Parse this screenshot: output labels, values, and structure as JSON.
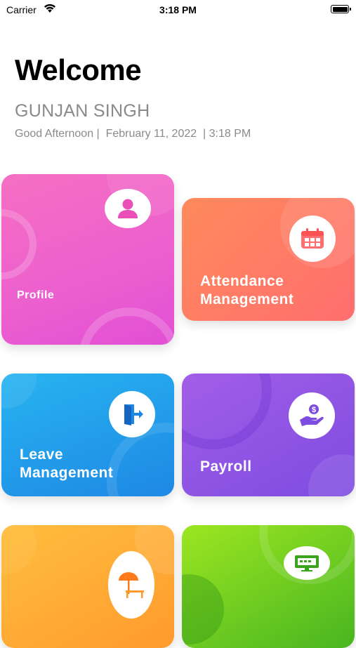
{
  "status_bar": {
    "carrier": "Carrier",
    "time": "3:18 PM",
    "wifi_icon": "wifi-icon",
    "battery_icon": "battery-icon"
  },
  "header": {
    "title": "Welcome",
    "user_name": "GUNJAN SINGH",
    "greeting": "Good Afternoon |  February 11, 2022  | 3:18 PM"
  },
  "tiles": [
    {
      "label": "Profile",
      "icon": "user-icon",
      "color_from": "#f56fc2",
      "color_to": "#e24fd5"
    },
    {
      "label": "Attendance Management",
      "line1": "Attendance",
      "line2": "Management",
      "icon": "calendar-icon",
      "color_from": "#ff8a5c",
      "color_to": "#ff6e6e"
    },
    {
      "label": "Leave Management",
      "line1": "Leave",
      "line2": "Management",
      "icon": "exit-door-icon",
      "color_from": "#28b4f0",
      "color_to": "#1e88e5"
    },
    {
      "label": "Payroll",
      "icon": "hand-dollar-icon",
      "color_from": "#a35ee8",
      "color_to": "#7d4ce0"
    },
    {
      "label": "",
      "icon": "beach-chair-umbrella-icon",
      "color_from": "#ffbe3d",
      "color_to": "#ff9a2e"
    },
    {
      "label": "",
      "icon": "monitor-icon",
      "color_from": "#9ce621",
      "color_to": "#48b521"
    }
  ]
}
